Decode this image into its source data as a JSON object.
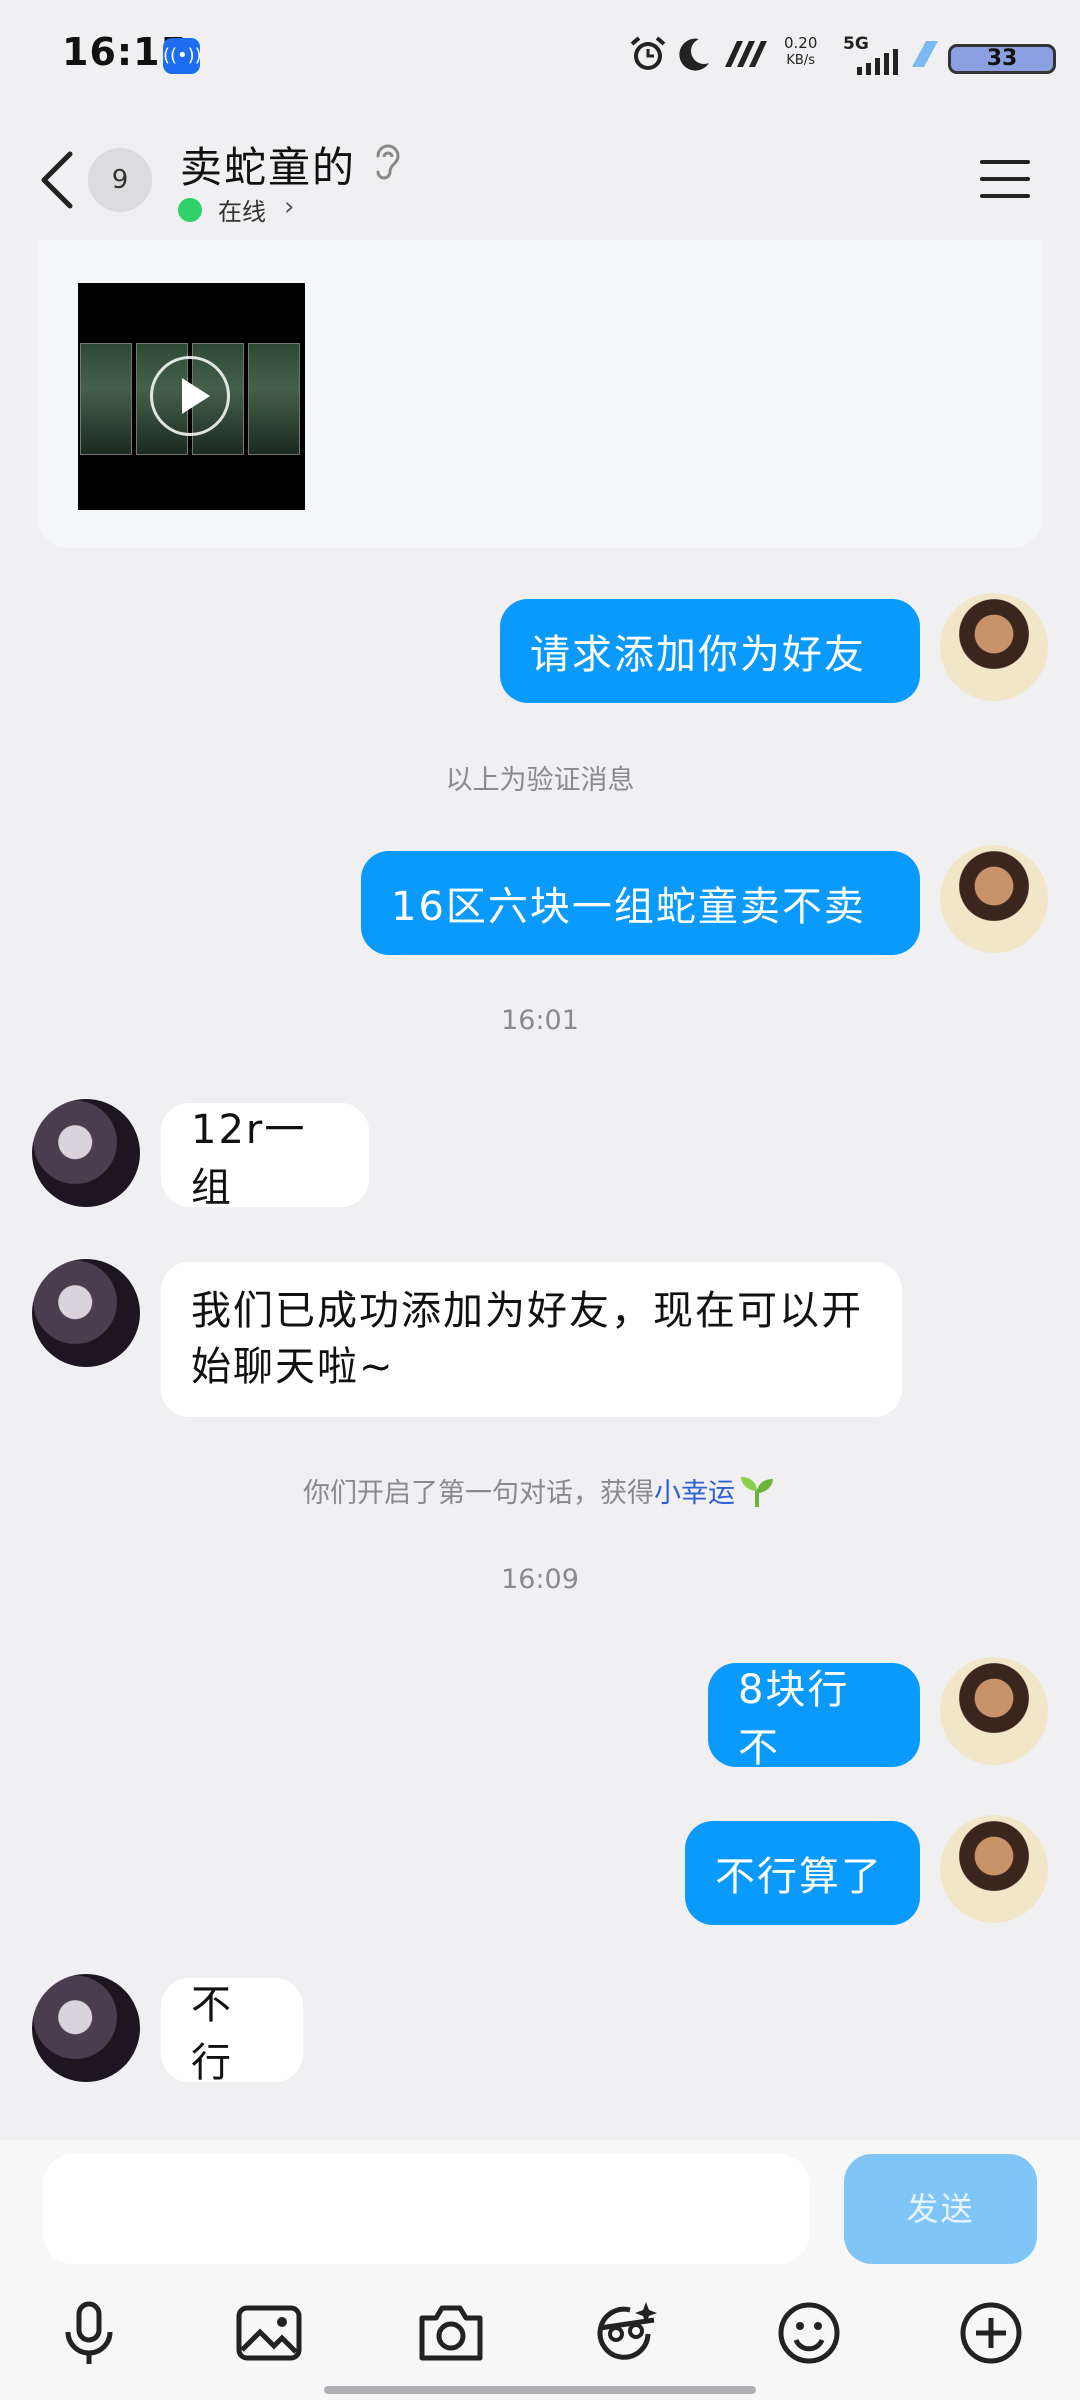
{
  "status_bar": {
    "time": "16:15",
    "network_speed_value": "0.20",
    "network_speed_unit": "KB/s",
    "network_type": "5G",
    "battery": "33",
    "icons": [
      "broadcast-icon",
      "alarm-icon",
      "moon-icon",
      "vibrate-icon",
      "signal-icon",
      "charging-icon",
      "battery-icon"
    ]
  },
  "header": {
    "unread_count": "9",
    "title": "卖蛇童的",
    "status": "在线",
    "status_color": "#2fd16b"
  },
  "messages": [
    {
      "side": "out",
      "text": "请求添加你为好友"
    },
    {
      "type": "system",
      "text": "以上为验证消息"
    },
    {
      "side": "out",
      "text": "16区六块一组蛇童卖不卖"
    },
    {
      "type": "time",
      "text": "16:01"
    },
    {
      "side": "in",
      "text": "12r一组"
    },
    {
      "side": "in",
      "text": "我们已成功添加为好友，现在可以开始聊天啦~"
    },
    {
      "type": "system",
      "text": "你们开启了第一句对话，获得",
      "highlight": "小幸运"
    },
    {
      "type": "time",
      "text": "16:09"
    },
    {
      "side": "out",
      "text": "8块行不"
    },
    {
      "side": "out",
      "text": "不行算了"
    },
    {
      "side": "in",
      "text": "不行"
    }
  ],
  "composer": {
    "send_label": "发送",
    "tools": [
      "microphone-icon",
      "image-icon",
      "camera-icon",
      "sticker-icon",
      "emoji-icon",
      "plus-icon"
    ]
  },
  "colors": {
    "outgoing_bubble": "#0a99fd",
    "incoming_bubble": "#ffffff",
    "background": "#f0f0f2",
    "send_button": "#7fc5f8"
  }
}
